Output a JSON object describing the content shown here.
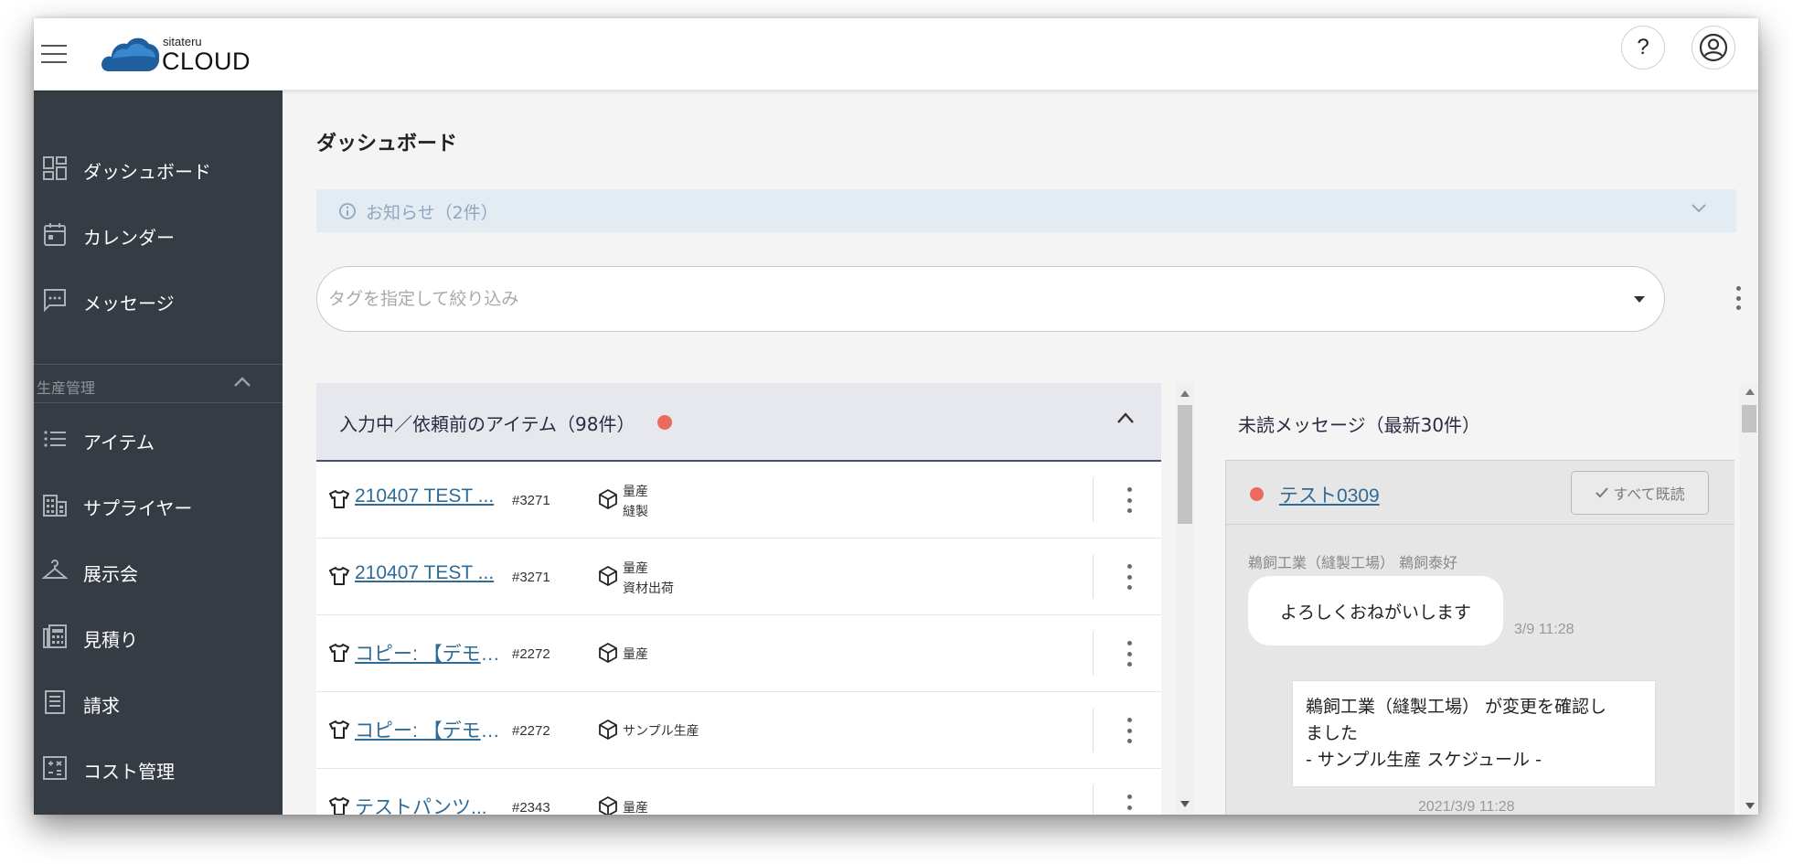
{
  "header": {
    "logo_small": "sitateru",
    "logo_big": "CLOUD",
    "help_label": "?"
  },
  "sidebar": {
    "items": [
      {
        "label": "ダッシュボード",
        "icon": "dashboard-icon"
      },
      {
        "label": "カレンダー",
        "icon": "calendar-icon"
      },
      {
        "label": "メッセージ",
        "icon": "message-icon"
      }
    ],
    "section": {
      "label": "生産管理"
    },
    "section_items": [
      {
        "label": "アイテム",
        "icon": "list-icon"
      },
      {
        "label": "サプライヤー",
        "icon": "building-icon"
      },
      {
        "label": "展示会",
        "icon": "hanger-icon"
      },
      {
        "label": "見積り",
        "icon": "calculator-icon"
      },
      {
        "label": "請求",
        "icon": "invoice-icon"
      },
      {
        "label": "コスト管理",
        "icon": "cost-icon"
      }
    ]
  },
  "main": {
    "title": "ダッシュボード",
    "notice": {
      "label": "お知らせ（2件）"
    },
    "tag_filter": {
      "placeholder": "タグを指定して絞り込み"
    }
  },
  "items_panel": {
    "title": "入力中／依頼前のアイテム（98件）",
    "rows": [
      {
        "name": "210407 TEST ...",
        "number": "#3271",
        "tags": [
          "量産",
          "縫製"
        ]
      },
      {
        "name": "210407 TEST ...",
        "number": "#3271",
        "tags": [
          "量産",
          "資材出荷"
        ]
      },
      {
        "name": "コピー: 【デモ/...",
        "number": "#2272",
        "tags": [
          "量産"
        ]
      },
      {
        "name": "コピー: 【デモ/...",
        "number": "#2272",
        "tags": [
          "サンプル生産"
        ]
      },
      {
        "name": "テストパンツ...",
        "number": "#2343",
        "tags": [
          "量産"
        ]
      }
    ]
  },
  "messages_panel": {
    "title": "未読メッセージ（最新30件）",
    "thread": {
      "name": "テスト0309",
      "read_all_label": "すべて既読",
      "sender": "鵜飼工業（縫製工場） 鵜飼泰好",
      "message": "よろしくおねがいします",
      "time": "3/9 11:28",
      "system_message_lines": [
        "鵜飼工業（縫製工場） が変更を確認し",
        "ました",
        "- サンプル生産 スケジュール -"
      ],
      "system_time": "2021/3/9 11:28"
    }
  },
  "colors": {
    "sidebar_bg": "#353c43",
    "link": "#2f6b95",
    "unread_dot": "#ec6a5c",
    "notice_bg": "#e3ebf3"
  }
}
